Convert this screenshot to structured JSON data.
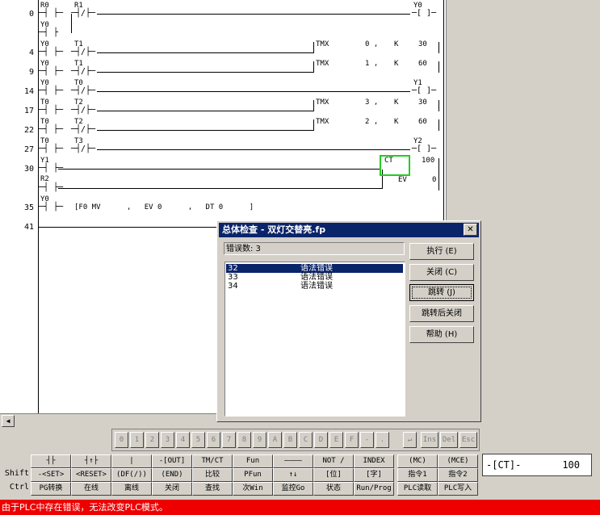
{
  "ladder": {
    "rows": [
      {
        "num": "0"
      },
      {
        "num": "4"
      },
      {
        "num": "9"
      },
      {
        "num": "14"
      },
      {
        "num": "17"
      },
      {
        "num": "22"
      },
      {
        "num": "27"
      },
      {
        "num": "30"
      },
      {
        "num": "35"
      },
      {
        "num": "41"
      }
    ],
    "labels": {
      "r0": "R0",
      "r1": "R1",
      "y0a": "Y0",
      "y0b": "Y0",
      "t1a": "T1",
      "y0c": "Y0",
      "t1b": "T1",
      "y0d": "Y0",
      "t0a": "T0",
      "t0b": "T0",
      "t2a": "T2",
      "t0c": "T0",
      "t2b": "T2",
      "t0d": "T0",
      "t3": "T3",
      "y1": "Y1",
      "r2": "R2",
      "y0e": "Y0",
      "coil_y0": "Y0",
      "coil_y1": "Y1",
      "coil_y2": "Y2"
    },
    "tmx": [
      {
        "label": "TMX",
        "num": "0 ,",
        "k": "K",
        "val": "30"
      },
      {
        "label": "TMX",
        "num": "1 ,",
        "k": "K",
        "val": "60"
      },
      {
        "label": "TMX",
        "num": "3 ,",
        "k": "K",
        "val": "30"
      },
      {
        "label": "TMX",
        "num": "2 ,",
        "k": "K",
        "val": "60"
      }
    ],
    "ct": {
      "label": "CT",
      "preset": "100",
      "ev_label": "EV",
      "ev_val": "0"
    },
    "fmv": {
      "text": "[F0 MV      ,   EV 0      ,   DT 0      ]"
    }
  },
  "dialog": {
    "title": "总体检查 - 双灯交替亮.fp",
    "close": "✕",
    "error_count": "错误数:  3",
    "errors": [
      {
        "num": "32",
        "msg": "语法错误"
      },
      {
        "num": "33",
        "msg": "语法错误"
      },
      {
        "num": "34",
        "msg": "语法错误"
      }
    ],
    "buttons": {
      "execute": "执行 (E)",
      "close": "关闭 (C)",
      "jump": "跳转 (J)",
      "jump_close": "跳转后关闭",
      "help": "帮助 (H)"
    }
  },
  "keypad": [
    "0",
    "1",
    "2",
    "3",
    "4",
    "5",
    "6",
    "7",
    "8",
    "9",
    "A",
    "B",
    "C",
    "D",
    "E",
    "F",
    "-",
    "."
  ],
  "keypad_right": [
    "↵",
    "Ins",
    "Del",
    "Esc"
  ],
  "fkeys": {
    "row_labels": {
      "shift": "Shift",
      "ctrl": "Ctrl"
    },
    "row1": [
      "┤├",
      "┤↑├",
      "|",
      "-[OUT]",
      "TM/CT",
      "Fun",
      "————",
      "NOT /",
      "INDEX",
      "(MC)",
      "(MCE)"
    ],
    "row2": [
      "-<SET>",
      "<RESET>",
      "(DF(/))",
      "(END)",
      "比较",
      "PFun",
      "↑↓",
      "[位]",
      "[字]",
      "指令1",
      "指令2"
    ],
    "row3": [
      "PG转换",
      "在线",
      "离线",
      "关闭",
      "查找",
      "次Win",
      "监控Go",
      "状态",
      "Run/Prog",
      "PLC读取",
      "PLC写入"
    ]
  },
  "ct_display": {
    "label": "-[CT]-",
    "value": "100"
  },
  "status_bar": "由于PLC中存在错误，无法改变PLC模式。"
}
